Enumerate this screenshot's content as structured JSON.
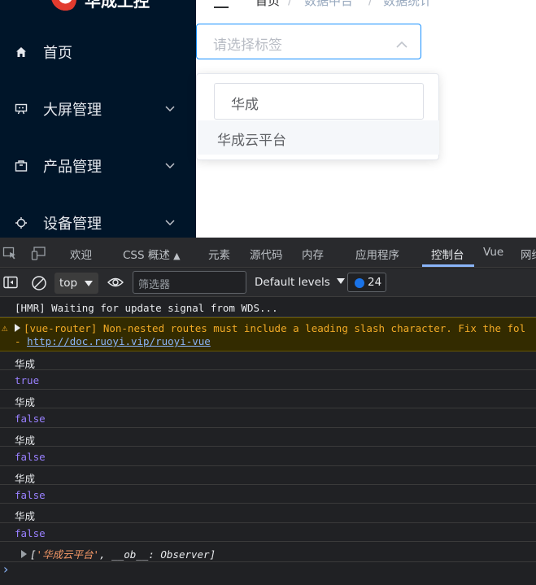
{
  "app": {
    "logo_text": "华成工控",
    "menu": [
      {
        "label": "首页",
        "icon": "home-icon",
        "has_children": false
      },
      {
        "label": "大屏管理",
        "icon": "monitor-icon",
        "has_children": true
      },
      {
        "label": "产品管理",
        "icon": "package-icon",
        "has_children": true
      },
      {
        "label": "设备管理",
        "icon": "device-icon",
        "has_children": true
      }
    ],
    "breadcrumb": [
      "首页",
      "数据中台",
      "数据统计"
    ],
    "select": {
      "placeholder": "请选择标签"
    },
    "dropdown": {
      "filter_value": "华成",
      "options": [
        "华成云平台"
      ]
    }
  },
  "devtools": {
    "tabs": [
      "欢迎",
      "CSS 概述",
      "元素",
      "源代码",
      "内存",
      "应用程序",
      "控制台",
      "Vue",
      "网络"
    ],
    "active_tab": "控制台",
    "context": "top",
    "filter_placeholder": "筛选器",
    "levels": "Default levels",
    "issues_count": "24",
    "messages": [
      {
        "type": "log",
        "text": "[HMR] Waiting for update signal from WDS..."
      },
      {
        "type": "warn",
        "text": "[vue-router] Non-nested routes must include a leading slash character. Fix the fol",
        "link_prefix": "- ",
        "link": "http://doc.ruoyi.vip/ruoyi-vue"
      },
      {
        "type": "log",
        "text": "华成"
      },
      {
        "type": "bool",
        "text": "true"
      },
      {
        "type": "log",
        "text": "华成"
      },
      {
        "type": "bool",
        "text": "false"
      },
      {
        "type": "log",
        "text": "华成"
      },
      {
        "type": "bool",
        "text": "false"
      },
      {
        "type": "log",
        "text": "华成"
      },
      {
        "type": "bool",
        "text": "false"
      },
      {
        "type": "log",
        "text": "华成"
      },
      {
        "type": "bool",
        "text": "false"
      }
    ],
    "array_preview": {
      "open": "[",
      "item": "'华成云平台'",
      "sep": ", ",
      "key": "__ob__",
      "colon": ": ",
      "val": "Observer",
      "close": "]"
    },
    "prompt": "›"
  }
}
